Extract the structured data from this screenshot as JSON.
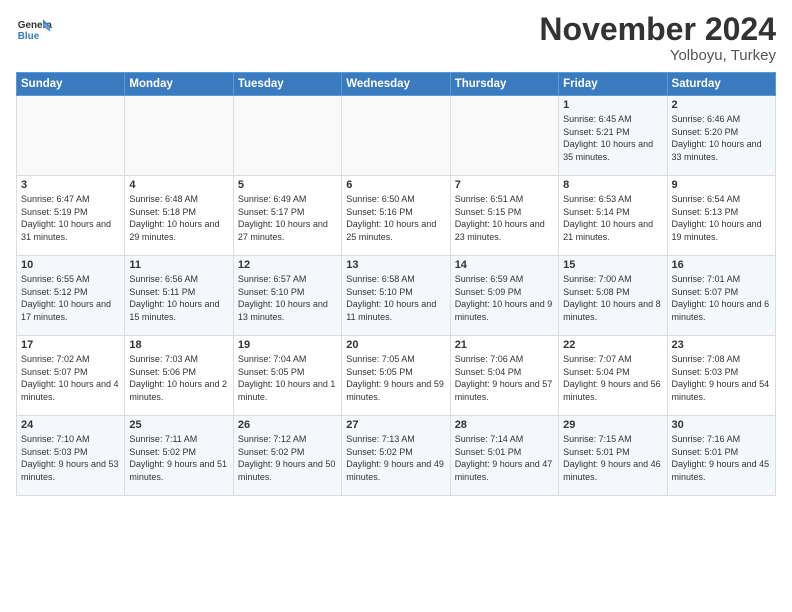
{
  "logo": {
    "line1": "General",
    "line2": "Blue"
  },
  "title": "November 2024",
  "location": "Yolboyu, Turkey",
  "weekdays": [
    "Sunday",
    "Monday",
    "Tuesday",
    "Wednesday",
    "Thursday",
    "Friday",
    "Saturday"
  ],
  "weeks": [
    [
      {
        "day": "",
        "sunrise": "",
        "sunset": "",
        "daylight": ""
      },
      {
        "day": "",
        "sunrise": "",
        "sunset": "",
        "daylight": ""
      },
      {
        "day": "",
        "sunrise": "",
        "sunset": "",
        "daylight": ""
      },
      {
        "day": "",
        "sunrise": "",
        "sunset": "",
        "daylight": ""
      },
      {
        "day": "",
        "sunrise": "",
        "sunset": "",
        "daylight": ""
      },
      {
        "day": "1",
        "sunrise": "Sunrise: 6:45 AM",
        "sunset": "Sunset: 5:21 PM",
        "daylight": "Daylight: 10 hours and 35 minutes."
      },
      {
        "day": "2",
        "sunrise": "Sunrise: 6:46 AM",
        "sunset": "Sunset: 5:20 PM",
        "daylight": "Daylight: 10 hours and 33 minutes."
      }
    ],
    [
      {
        "day": "3",
        "sunrise": "Sunrise: 6:47 AM",
        "sunset": "Sunset: 5:19 PM",
        "daylight": "Daylight: 10 hours and 31 minutes."
      },
      {
        "day": "4",
        "sunrise": "Sunrise: 6:48 AM",
        "sunset": "Sunset: 5:18 PM",
        "daylight": "Daylight: 10 hours and 29 minutes."
      },
      {
        "day": "5",
        "sunrise": "Sunrise: 6:49 AM",
        "sunset": "Sunset: 5:17 PM",
        "daylight": "Daylight: 10 hours and 27 minutes."
      },
      {
        "day": "6",
        "sunrise": "Sunrise: 6:50 AM",
        "sunset": "Sunset: 5:16 PM",
        "daylight": "Daylight: 10 hours and 25 minutes."
      },
      {
        "day": "7",
        "sunrise": "Sunrise: 6:51 AM",
        "sunset": "Sunset: 5:15 PM",
        "daylight": "Daylight: 10 hours and 23 minutes."
      },
      {
        "day": "8",
        "sunrise": "Sunrise: 6:53 AM",
        "sunset": "Sunset: 5:14 PM",
        "daylight": "Daylight: 10 hours and 21 minutes."
      },
      {
        "day": "9",
        "sunrise": "Sunrise: 6:54 AM",
        "sunset": "Sunset: 5:13 PM",
        "daylight": "Daylight: 10 hours and 19 minutes."
      }
    ],
    [
      {
        "day": "10",
        "sunrise": "Sunrise: 6:55 AM",
        "sunset": "Sunset: 5:12 PM",
        "daylight": "Daylight: 10 hours and 17 minutes."
      },
      {
        "day": "11",
        "sunrise": "Sunrise: 6:56 AM",
        "sunset": "Sunset: 5:11 PM",
        "daylight": "Daylight: 10 hours and 15 minutes."
      },
      {
        "day": "12",
        "sunrise": "Sunrise: 6:57 AM",
        "sunset": "Sunset: 5:10 PM",
        "daylight": "Daylight: 10 hours and 13 minutes."
      },
      {
        "day": "13",
        "sunrise": "Sunrise: 6:58 AM",
        "sunset": "Sunset: 5:10 PM",
        "daylight": "Daylight: 10 hours and 11 minutes."
      },
      {
        "day": "14",
        "sunrise": "Sunrise: 6:59 AM",
        "sunset": "Sunset: 5:09 PM",
        "daylight": "Daylight: 10 hours and 9 minutes."
      },
      {
        "day": "15",
        "sunrise": "Sunrise: 7:00 AM",
        "sunset": "Sunset: 5:08 PM",
        "daylight": "Daylight: 10 hours and 8 minutes."
      },
      {
        "day": "16",
        "sunrise": "Sunrise: 7:01 AM",
        "sunset": "Sunset: 5:07 PM",
        "daylight": "Daylight: 10 hours and 6 minutes."
      }
    ],
    [
      {
        "day": "17",
        "sunrise": "Sunrise: 7:02 AM",
        "sunset": "Sunset: 5:07 PM",
        "daylight": "Daylight: 10 hours and 4 minutes."
      },
      {
        "day": "18",
        "sunrise": "Sunrise: 7:03 AM",
        "sunset": "Sunset: 5:06 PM",
        "daylight": "Daylight: 10 hours and 2 minutes."
      },
      {
        "day": "19",
        "sunrise": "Sunrise: 7:04 AM",
        "sunset": "Sunset: 5:05 PM",
        "daylight": "Daylight: 10 hours and 1 minute."
      },
      {
        "day": "20",
        "sunrise": "Sunrise: 7:05 AM",
        "sunset": "Sunset: 5:05 PM",
        "daylight": "Daylight: 9 hours and 59 minutes."
      },
      {
        "day": "21",
        "sunrise": "Sunrise: 7:06 AM",
        "sunset": "Sunset: 5:04 PM",
        "daylight": "Daylight: 9 hours and 57 minutes."
      },
      {
        "day": "22",
        "sunrise": "Sunrise: 7:07 AM",
        "sunset": "Sunset: 5:04 PM",
        "daylight": "Daylight: 9 hours and 56 minutes."
      },
      {
        "day": "23",
        "sunrise": "Sunrise: 7:08 AM",
        "sunset": "Sunset: 5:03 PM",
        "daylight": "Daylight: 9 hours and 54 minutes."
      }
    ],
    [
      {
        "day": "24",
        "sunrise": "Sunrise: 7:10 AM",
        "sunset": "Sunset: 5:03 PM",
        "daylight": "Daylight: 9 hours and 53 minutes."
      },
      {
        "day": "25",
        "sunrise": "Sunrise: 7:11 AM",
        "sunset": "Sunset: 5:02 PM",
        "daylight": "Daylight: 9 hours and 51 minutes."
      },
      {
        "day": "26",
        "sunrise": "Sunrise: 7:12 AM",
        "sunset": "Sunset: 5:02 PM",
        "daylight": "Daylight: 9 hours and 50 minutes."
      },
      {
        "day": "27",
        "sunrise": "Sunrise: 7:13 AM",
        "sunset": "Sunset: 5:02 PM",
        "daylight": "Daylight: 9 hours and 49 minutes."
      },
      {
        "day": "28",
        "sunrise": "Sunrise: 7:14 AM",
        "sunset": "Sunset: 5:01 PM",
        "daylight": "Daylight: 9 hours and 47 minutes."
      },
      {
        "day": "29",
        "sunrise": "Sunrise: 7:15 AM",
        "sunset": "Sunset: 5:01 PM",
        "daylight": "Daylight: 9 hours and 46 minutes."
      },
      {
        "day": "30",
        "sunrise": "Sunrise: 7:16 AM",
        "sunset": "Sunset: 5:01 PM",
        "daylight": "Daylight: 9 hours and 45 minutes."
      }
    ]
  ]
}
